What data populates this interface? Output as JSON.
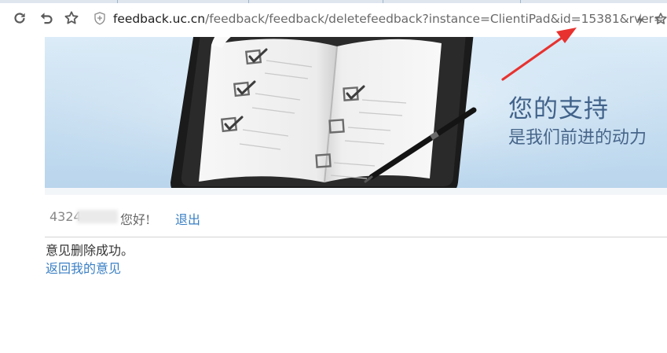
{
  "browser": {
    "address_host": "feedback.uc.cn",
    "address_path": "/feedback/feedback/deletefeedback?instance=ClientiPad&id=15381&rver="
  },
  "banner": {
    "slogan_main": "您的支持",
    "slogan_sub": "是我们前进的动力"
  },
  "user": {
    "id_visible": "4324",
    "greeting": "您好!",
    "logout_label": "退出"
  },
  "content": {
    "message": "意见删除成功。",
    "back_link": "返回我的意见"
  },
  "colors": {
    "link": "#3a7fc4",
    "slogan": "#41628a",
    "annotation_arrow": "#e8322f"
  }
}
